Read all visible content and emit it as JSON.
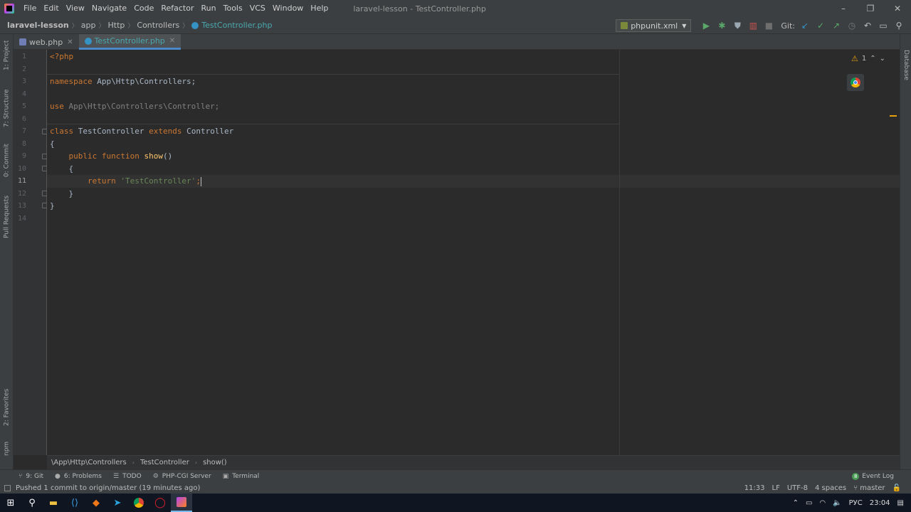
{
  "menubar": {
    "items": [
      "File",
      "Edit",
      "View",
      "Navigate",
      "Code",
      "Refactor",
      "Run",
      "Tools",
      "VCS",
      "Window",
      "Help"
    ],
    "title": "laravel-lesson - TestController.php",
    "minimize": "–",
    "maximize": "❐",
    "close": "✕"
  },
  "navbar": {
    "crumbs": [
      "laravel-lesson",
      "app",
      "Http",
      "Controllers",
      "TestController.php"
    ],
    "run_config": "phpunit.xml",
    "git_label": "Git:"
  },
  "tabs": [
    {
      "label": "web.php",
      "active": false
    },
    {
      "label": "TestController.php",
      "active": true
    }
  ],
  "left_strip": [
    "1: Project",
    "7: Structure",
    "0: Commit",
    "Pull Requests",
    "2: Favorites",
    "npm"
  ],
  "right_strip": [
    "Database"
  ],
  "editor": {
    "line_numbers": [
      "1",
      "2",
      "3",
      "4",
      "5",
      "6",
      "7",
      "8",
      "9",
      "10",
      "11",
      "12",
      "13",
      "14"
    ],
    "current_line": "11",
    "warnings": "1",
    "code": {
      "l1": "<?php",
      "l3_kw": "namespace",
      "l3_rest": " App\\Http\\Controllers;",
      "l5_kw": "use",
      "l5_rest": " App\\Http\\Controllers\\Controller;",
      "l7_kw1": "class",
      "l7_name": " TestController ",
      "l7_kw2": "extends",
      "l7_parent": " Controller",
      "l8": "{",
      "l9_kw1": "    public",
      "l9_kw2": " function",
      "l9_fn": " show",
      "l9_rest": "()",
      "l10": "    {",
      "l11_kw": "        return",
      "l11_str": " 'TestController'",
      "l11_rest": ";",
      "l12": "    }",
      "l13": "}"
    }
  },
  "bottom_crumb": [
    "\\App\\Http\\Controllers",
    "TestController",
    "show()"
  ],
  "tool_windows": [
    {
      "icon": "git-icon",
      "label": "9: Git"
    },
    {
      "icon": "problems-icon",
      "label": "6: Problems"
    },
    {
      "icon": "todo-icon",
      "label": "TODO"
    },
    {
      "icon": "php-cgi-icon",
      "label": "PHP-CGI Server"
    },
    {
      "icon": "terminal-icon",
      "label": "Terminal"
    }
  ],
  "event_log": {
    "count": "8",
    "label": "Event Log"
  },
  "status": {
    "message": "Pushed 1 commit to origin/master (19 minutes ago)",
    "position": "11:33",
    "line_sep": "LF",
    "encoding": "UTF-8",
    "indent": "4 spaces",
    "branch": "master"
  },
  "taskbar": {
    "lang": "РУС",
    "time": "23:04"
  }
}
